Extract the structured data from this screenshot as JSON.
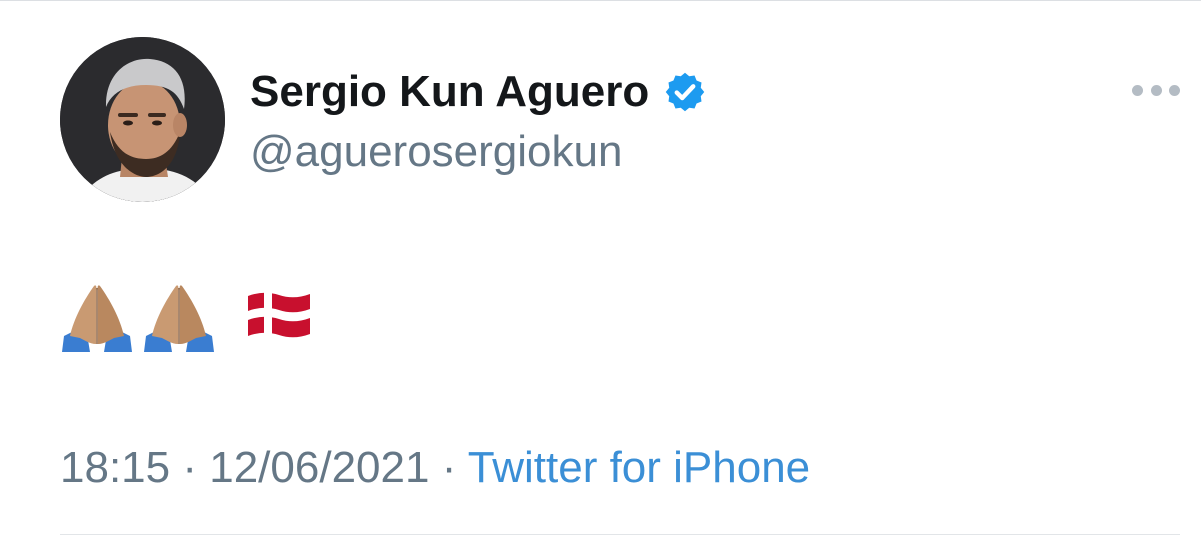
{
  "tweet": {
    "author": {
      "display_name": "Sergio Kun Aguero",
      "handle": "@aguerosergiokun",
      "verified": true
    },
    "body_emoji": [
      "folded-hands-medium-skin-tone",
      "folded-hands-medium-skin-tone",
      "flag-denmark"
    ],
    "time": "18:15",
    "separator": "·",
    "date": "12/06/2021",
    "source": "Twitter for iPhone"
  },
  "colors": {
    "name": "#14171a",
    "muted": "#657786",
    "link": "#3b8fd6",
    "verified": "#1d9bf0",
    "flag_red": "#c8102e"
  }
}
